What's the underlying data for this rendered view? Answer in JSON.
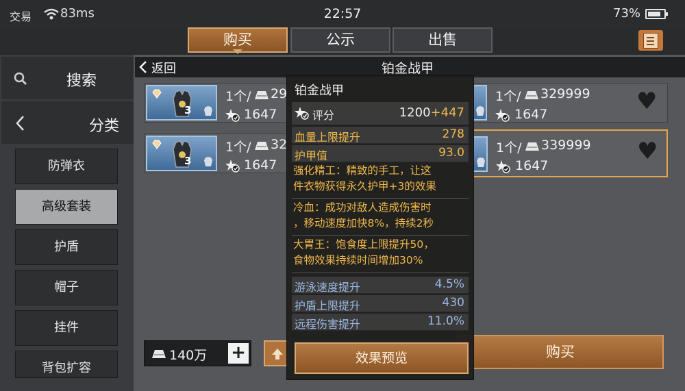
{
  "status_bar": {
    "carrier": "交易",
    "ping": "83ms",
    "time": "22:57",
    "battery_percent": "73%",
    "battery_level": 0.73
  },
  "tabs": [
    {
      "label": "购买",
      "active": true
    },
    {
      "label": "公示",
      "active": false
    },
    {
      "label": "出售",
      "active": false
    }
  ],
  "sidebar": {
    "search_label": "搜索",
    "category_label": "分类",
    "categories": [
      {
        "label": "防弹衣",
        "active": false
      },
      {
        "label": "高级套装",
        "active": true
      },
      {
        "label": "护盾",
        "active": false
      },
      {
        "label": "帽子",
        "active": false
      },
      {
        "label": "挂件",
        "active": false
      },
      {
        "label": "背包扩容",
        "active": false
      }
    ]
  },
  "list": {
    "back_label": "返回",
    "title": "铂金战甲",
    "listings": [
      {
        "qty_prefix": "1个/",
        "price": "29",
        "score": "1647",
        "level": "3"
      },
      {
        "qty_prefix": "1个/",
        "price": "329999",
        "score": "1647"
      },
      {
        "qty_prefix": "1个/",
        "price": "32",
        "score": "1647",
        "level": "3"
      },
      {
        "qty_prefix": "1个/",
        "price": "339999",
        "score": "1647",
        "selected": true
      }
    ]
  },
  "bottom": {
    "funds": "140万",
    "add_label": "+",
    "buy_label": "购买"
  },
  "tooltip": {
    "title": "铂金战甲",
    "score_label": "评分",
    "score_base": "1200",
    "score_bonus": "+447",
    "stats_gold": [
      {
        "label": "血量上限提升",
        "value": "278"
      },
      {
        "label": "护甲值",
        "value": "93.0"
      }
    ],
    "descriptions": [
      {
        "line1": "强化精工：精致的手工，让这",
        "line2": "件衣物获得永久护甲+3的效果"
      },
      {
        "line1": "冷血：成功对敌人造成伤害时",
        "line2": "，移动速度加快8%，持续2秒"
      },
      {
        "line1": "大胃王：饱食度上限提升50，",
        "line2": "食物效果持续时间增加30%"
      }
    ],
    "stats_blue": [
      {
        "label": "游泳速度提升",
        "value": "4.5%"
      },
      {
        "label": "护盾上限提升",
        "value": "430"
      },
      {
        "label": "远程伤害提升",
        "value": "11.0%"
      }
    ],
    "preview_label": "效果预览"
  },
  "colors": {
    "accent": "#b0733c",
    "gold_text": "#f0b84a",
    "blue_text": "#9cb8e0",
    "panel": "#55575a"
  },
  "icons": [
    "wifi-icon",
    "battery-icon",
    "clipboard-icon",
    "search-icon",
    "chevron-left-icon",
    "diamond-icon",
    "armor-icon",
    "silver-ingot-icon",
    "score-star-icon",
    "heart-icon",
    "plus-icon",
    "arrow-up-icon"
  ]
}
